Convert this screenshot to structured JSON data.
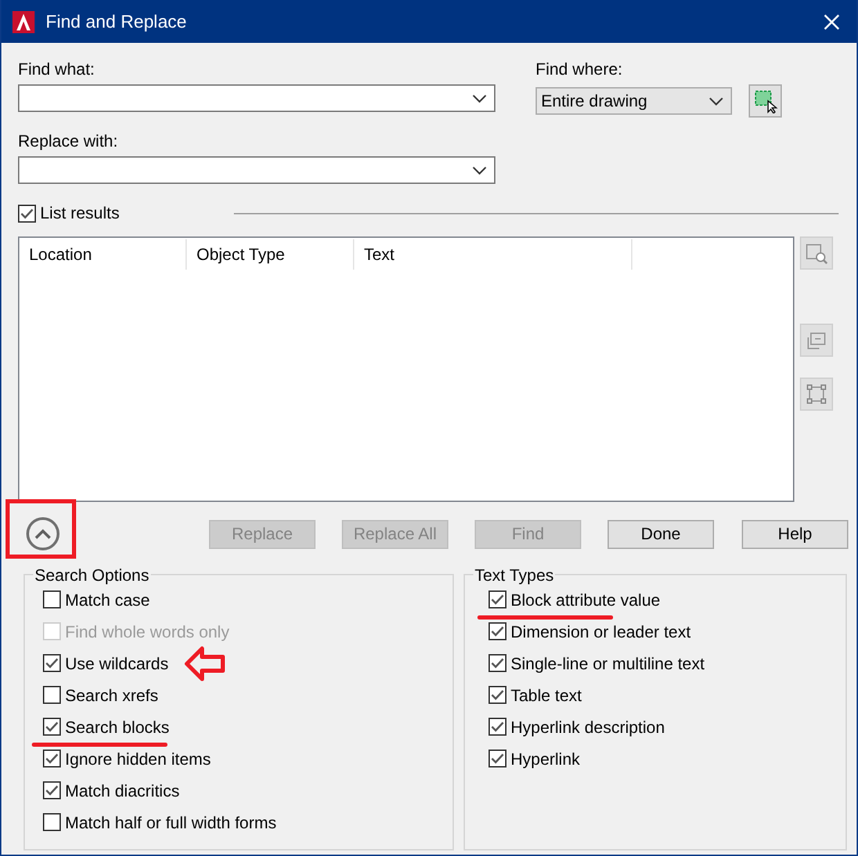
{
  "window": {
    "title": "Find and Replace"
  },
  "find_what": {
    "label": "Find what:"
  },
  "find_where": {
    "label": "Find where:",
    "value": "Entire drawing"
  },
  "replace_with": {
    "label": "Replace with:"
  },
  "list_results": {
    "label": "List results",
    "checked": true
  },
  "table": {
    "columns": [
      "Location",
      "Object Type",
      "Text"
    ]
  },
  "collapse_button": {
    "highlighted": true
  },
  "buttons": [
    {
      "label": "Replace",
      "disabled": true
    },
    {
      "label": "Replace All",
      "disabled": true
    },
    {
      "label": "Find",
      "disabled": true
    },
    {
      "label": "Done",
      "disabled": false
    },
    {
      "label": "Help",
      "disabled": false
    }
  ],
  "search_options": {
    "title": "Search Options",
    "items": [
      {
        "label": "Match case",
        "checked": false,
        "disabled": false
      },
      {
        "label": "Find whole words only",
        "checked": false,
        "disabled": true
      },
      {
        "label": "Use wildcards",
        "checked": true,
        "disabled": false,
        "arrow_annotation": true
      },
      {
        "label": "Search xrefs",
        "checked": false,
        "disabled": false
      },
      {
        "label": "Search blocks",
        "checked": true,
        "disabled": false,
        "underline_annotation": true
      },
      {
        "label": "Ignore hidden items",
        "checked": true,
        "disabled": false
      },
      {
        "label": "Match diacritics",
        "checked": true,
        "disabled": false
      },
      {
        "label": "Match half or full width forms",
        "checked": false,
        "disabled": false
      }
    ]
  },
  "text_types": {
    "title": "Text Types",
    "items": [
      {
        "label": "Block attribute value",
        "checked": true,
        "disabled": false,
        "underline_annotation": true
      },
      {
        "label": "Dimension or leader text",
        "checked": true,
        "disabled": false
      },
      {
        "label": "Single-line or multiline text",
        "checked": true,
        "disabled": false
      },
      {
        "label": "Table text",
        "checked": true,
        "disabled": false
      },
      {
        "label": "Hyperlink description",
        "checked": true,
        "disabled": false
      },
      {
        "label": "Hyperlink",
        "checked": true,
        "disabled": false
      }
    ]
  }
}
